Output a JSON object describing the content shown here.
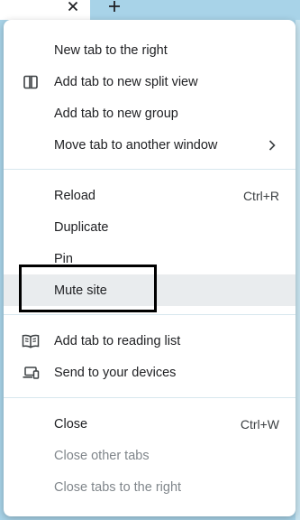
{
  "tabstrip": {
    "close_icon": "close-icon",
    "new_tab_icon": "plus-icon"
  },
  "menu": {
    "groups": [
      {
        "items": [
          {
            "label": "New tab to the right",
            "icon": null,
            "shortcut": null,
            "submenu": false,
            "disabled": false
          },
          {
            "label": "Add tab to new split view",
            "icon": "split-view-icon",
            "shortcut": null,
            "submenu": false,
            "disabled": false
          },
          {
            "label": "Add tab to new group",
            "icon": null,
            "shortcut": null,
            "submenu": false,
            "disabled": false
          },
          {
            "label": "Move tab to another window",
            "icon": null,
            "shortcut": null,
            "submenu": true,
            "disabled": false
          }
        ]
      },
      {
        "items": [
          {
            "label": "Reload",
            "icon": null,
            "shortcut": "Ctrl+R",
            "submenu": false,
            "disabled": false
          },
          {
            "label": "Duplicate",
            "icon": null,
            "shortcut": null,
            "submenu": false,
            "disabled": false
          },
          {
            "label": "Pin",
            "icon": null,
            "shortcut": null,
            "submenu": false,
            "disabled": false
          },
          {
            "label": "Mute site",
            "icon": null,
            "shortcut": null,
            "submenu": false,
            "disabled": false,
            "hovered": true
          }
        ]
      },
      {
        "items": [
          {
            "label": "Add tab to reading list",
            "icon": "reading-list-icon",
            "shortcut": null,
            "submenu": false,
            "disabled": false
          },
          {
            "label": "Send to your devices",
            "icon": "devices-icon",
            "shortcut": null,
            "submenu": false,
            "disabled": false
          }
        ]
      },
      {
        "items": [
          {
            "label": "Close",
            "icon": null,
            "shortcut": "Ctrl+W",
            "submenu": false,
            "disabled": false
          },
          {
            "label": "Close other tabs",
            "icon": null,
            "shortcut": null,
            "submenu": false,
            "disabled": true
          },
          {
            "label": "Close tabs to the right",
            "icon": null,
            "shortcut": null,
            "submenu": false,
            "disabled": true
          }
        ]
      }
    ]
  },
  "colors": {
    "tabstrip_bg": "#a8d3e8",
    "menu_bg": "#ffffff",
    "hover_bg": "#e9ecee",
    "separator": "#d7e7ee",
    "text": "#202124",
    "disabled_text": "#80868b",
    "annotation_box": "#000000"
  }
}
